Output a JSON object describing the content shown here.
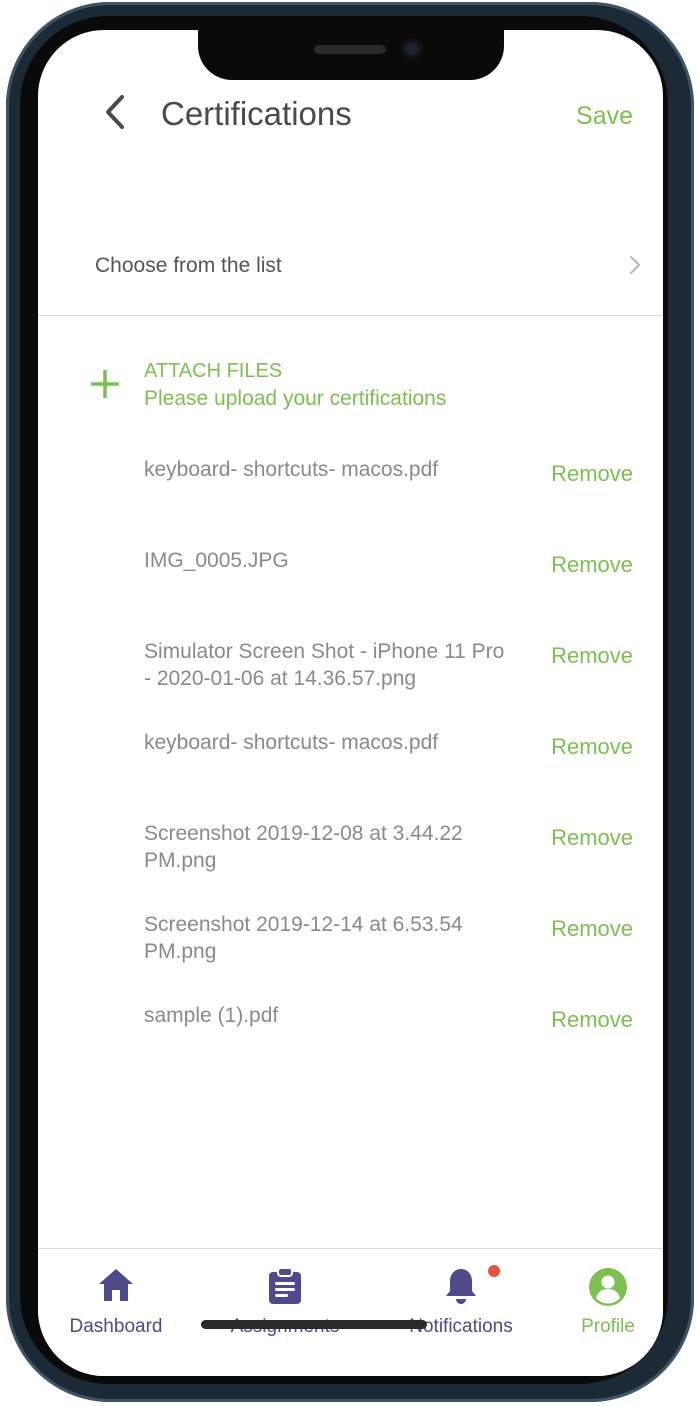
{
  "header": {
    "title": "Certifications",
    "save_label": "Save"
  },
  "choose": {
    "label": "Choose from the list"
  },
  "attach": {
    "title": "ATTACH FILES",
    "subtitle": "Please upload your certifications"
  },
  "files": [
    {
      "name": "keyboard- shortcuts- macos.pdf",
      "action": "Remove"
    },
    {
      "name": "IMG_0005.JPG",
      "action": "Remove"
    },
    {
      "name": "Simulator Screen Shot - iPhone 11 Pro - 2020-01-06 at 14.36.57.png",
      "action": "Remove"
    },
    {
      "name": "keyboard- shortcuts- macos.pdf",
      "action": "Remove"
    },
    {
      "name": "Screenshot 2019-12-08 at 3.44.22 PM.png",
      "action": "Remove"
    },
    {
      "name": "Screenshot 2019-12-14 at 6.53.54 PM.png",
      "action": "Remove"
    },
    {
      "name": "sample (1).pdf",
      "action": "Remove"
    }
  ],
  "tabbar": {
    "dashboard": "Dashboard",
    "assignments": "Assignments",
    "notifications": "Notifications",
    "profile": "Profile"
  },
  "colors": {
    "accent_green": "#7cc04f",
    "tab_purple": "#4f4a8c",
    "badge_red": "#e5533d"
  },
  "icons": {
    "back": "chevron-left-icon",
    "chevron": "chevron-right-icon",
    "attach": "plus-icon",
    "dashboard": "home-icon",
    "assignments": "clipboard-icon",
    "notifications": "bell-icon",
    "profile": "user-circle-icon"
  }
}
